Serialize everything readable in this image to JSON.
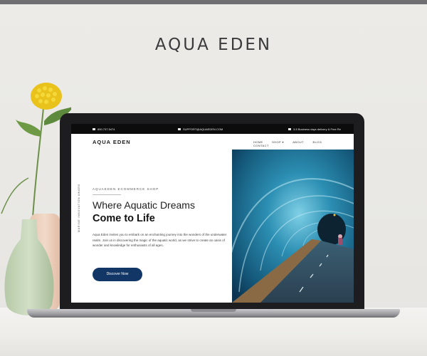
{
  "mockup": {
    "title": "AQUA EDEN"
  },
  "site": {
    "topbar": {
      "phone": "850.737.5474",
      "email": "SUPPORT@AQUAEDEN.COM",
      "shipping": "3-5 Business days delivery & Free Re"
    },
    "logo": "AQUA EDEN",
    "menu": [
      "HOME",
      "SHOP ▾",
      "ABOUT",
      "BLOG",
      "CONTACT"
    ],
    "hero": {
      "eyebrow": "AQUAEDEN ECOMMERCE SHOP",
      "vertical_label": "MARINE INNOVATION AWARD",
      "heading_line1": "Where Aquatic Dreams",
      "heading_line2": "Come to Life",
      "paragraph": "Aqua Eden invites you to embark on an enchanting journey into the wonders of the underwater realm. Join us in discovering the magic of the aquatic world, as we strive to create an oasis of wonder and knowledge for enthusiasts of all ages.",
      "cta": "Discover Now"
    }
  },
  "colors": {
    "background": "#ecebe7",
    "cta": "#123766",
    "topstrip": "#0c0c0d"
  }
}
